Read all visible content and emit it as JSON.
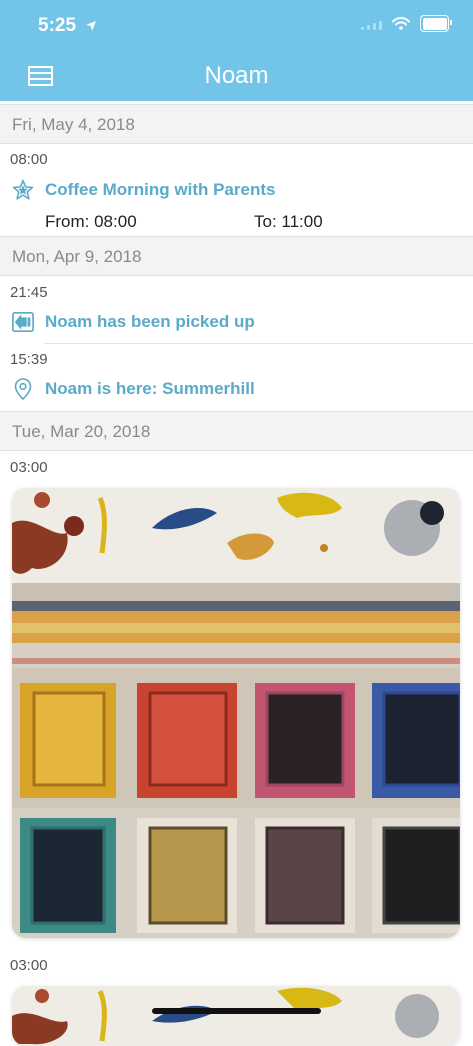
{
  "status": {
    "time": "5:25"
  },
  "header": {
    "title": "Noam"
  },
  "feed": {
    "date1": "Fri, May 4, 2018",
    "item1": {
      "time": "08:00",
      "title": "Coffee Morning with Parents",
      "from": "From: 08:00",
      "to": "To: 11:00"
    },
    "date2": "Mon, Apr 9, 2018",
    "item2": {
      "time": "21:45",
      "title": "Noam has been picked up"
    },
    "item3": {
      "time": "15:39",
      "title": "Noam is here: Summerhill"
    },
    "date3": "Tue, Mar 20, 2018",
    "item4": {
      "time": "03:00"
    },
    "item5": {
      "time": "03:00"
    }
  },
  "colors": {
    "header": "#72c4e8",
    "accent": "#5aaac9"
  }
}
